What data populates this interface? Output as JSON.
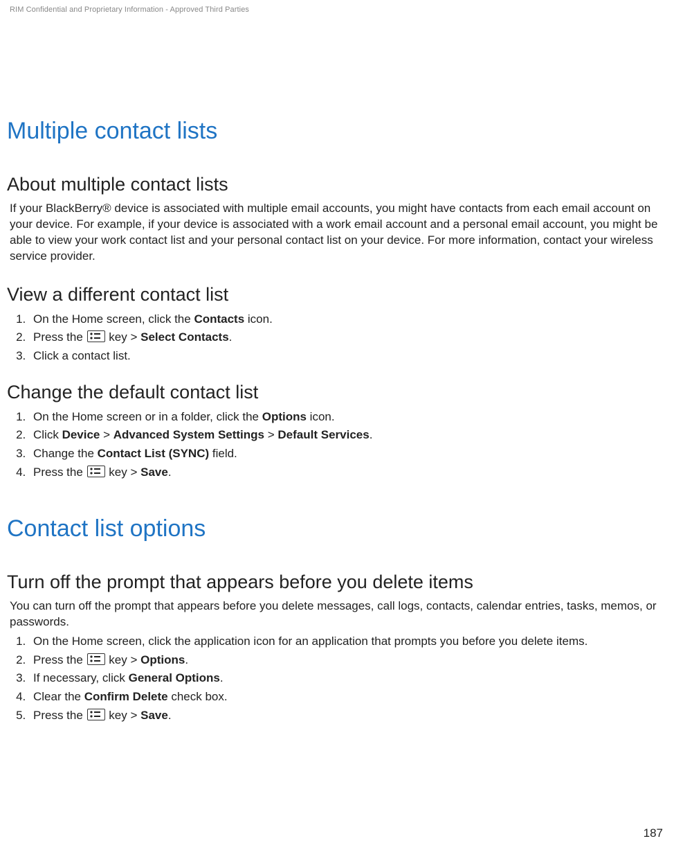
{
  "header_confidential": "RIM Confidential and Proprietary Information - Approved Third Parties",
  "page_number": "187",
  "section1": {
    "title": "Multiple contact lists",
    "sub1": {
      "heading": "About multiple contact lists",
      "para": "If your BlackBerry® device is associated with multiple email accounts, you might have contacts from each email account on your device. For example, if your device is associated with a work email account and a personal email account, you might be able to view your work contact list and your personal contact list on your device. For more information, contact your wireless service provider."
    },
    "sub2": {
      "heading": "View a different contact list",
      "step1_a": "On the Home screen, click the ",
      "step1_b": "Contacts",
      "step1_c": " icon.",
      "step2_a": "Press the ",
      "step2_b": " key > ",
      "step2_c": "Select Contacts",
      "step2_d": ".",
      "step3": "Click a contact list."
    },
    "sub3": {
      "heading": "Change the default contact list",
      "step1_a": "On the Home screen or in a folder, click the ",
      "step1_b": "Options",
      "step1_c": " icon.",
      "step2_a": "Click ",
      "step2_b": "Device",
      "step2_c": " > ",
      "step2_d": "Advanced System Settings",
      "step2_e": " > ",
      "step2_f": "Default Services",
      "step2_g": ".",
      "step3_a": "Change the ",
      "step3_b": "Contact List (SYNC)",
      "step3_c": " field.",
      "step4_a": "Press the ",
      "step4_b": " key > ",
      "step4_c": "Save",
      "step4_d": "."
    }
  },
  "section2": {
    "title": "Contact list options",
    "sub1": {
      "heading": "Turn off the prompt that appears before you delete items",
      "para": "You can turn off the prompt that appears before you delete messages, call logs, contacts, calendar entries, tasks, memos, or passwords.",
      "step1": "On the Home screen, click the application icon for an application that prompts you before you delete items.",
      "step2_a": "Press the ",
      "step2_b": " key > ",
      "step2_c": "Options",
      "step2_d": ".",
      "step3_a": "If necessary, click ",
      "step3_b": "General Options",
      "step3_c": ".",
      "step4_a": "Clear the ",
      "step4_b": "Confirm Delete",
      "step4_c": " check box.",
      "step5_a": "Press the ",
      "step5_b": " key > ",
      "step5_c": "Save",
      "step5_d": "."
    }
  }
}
